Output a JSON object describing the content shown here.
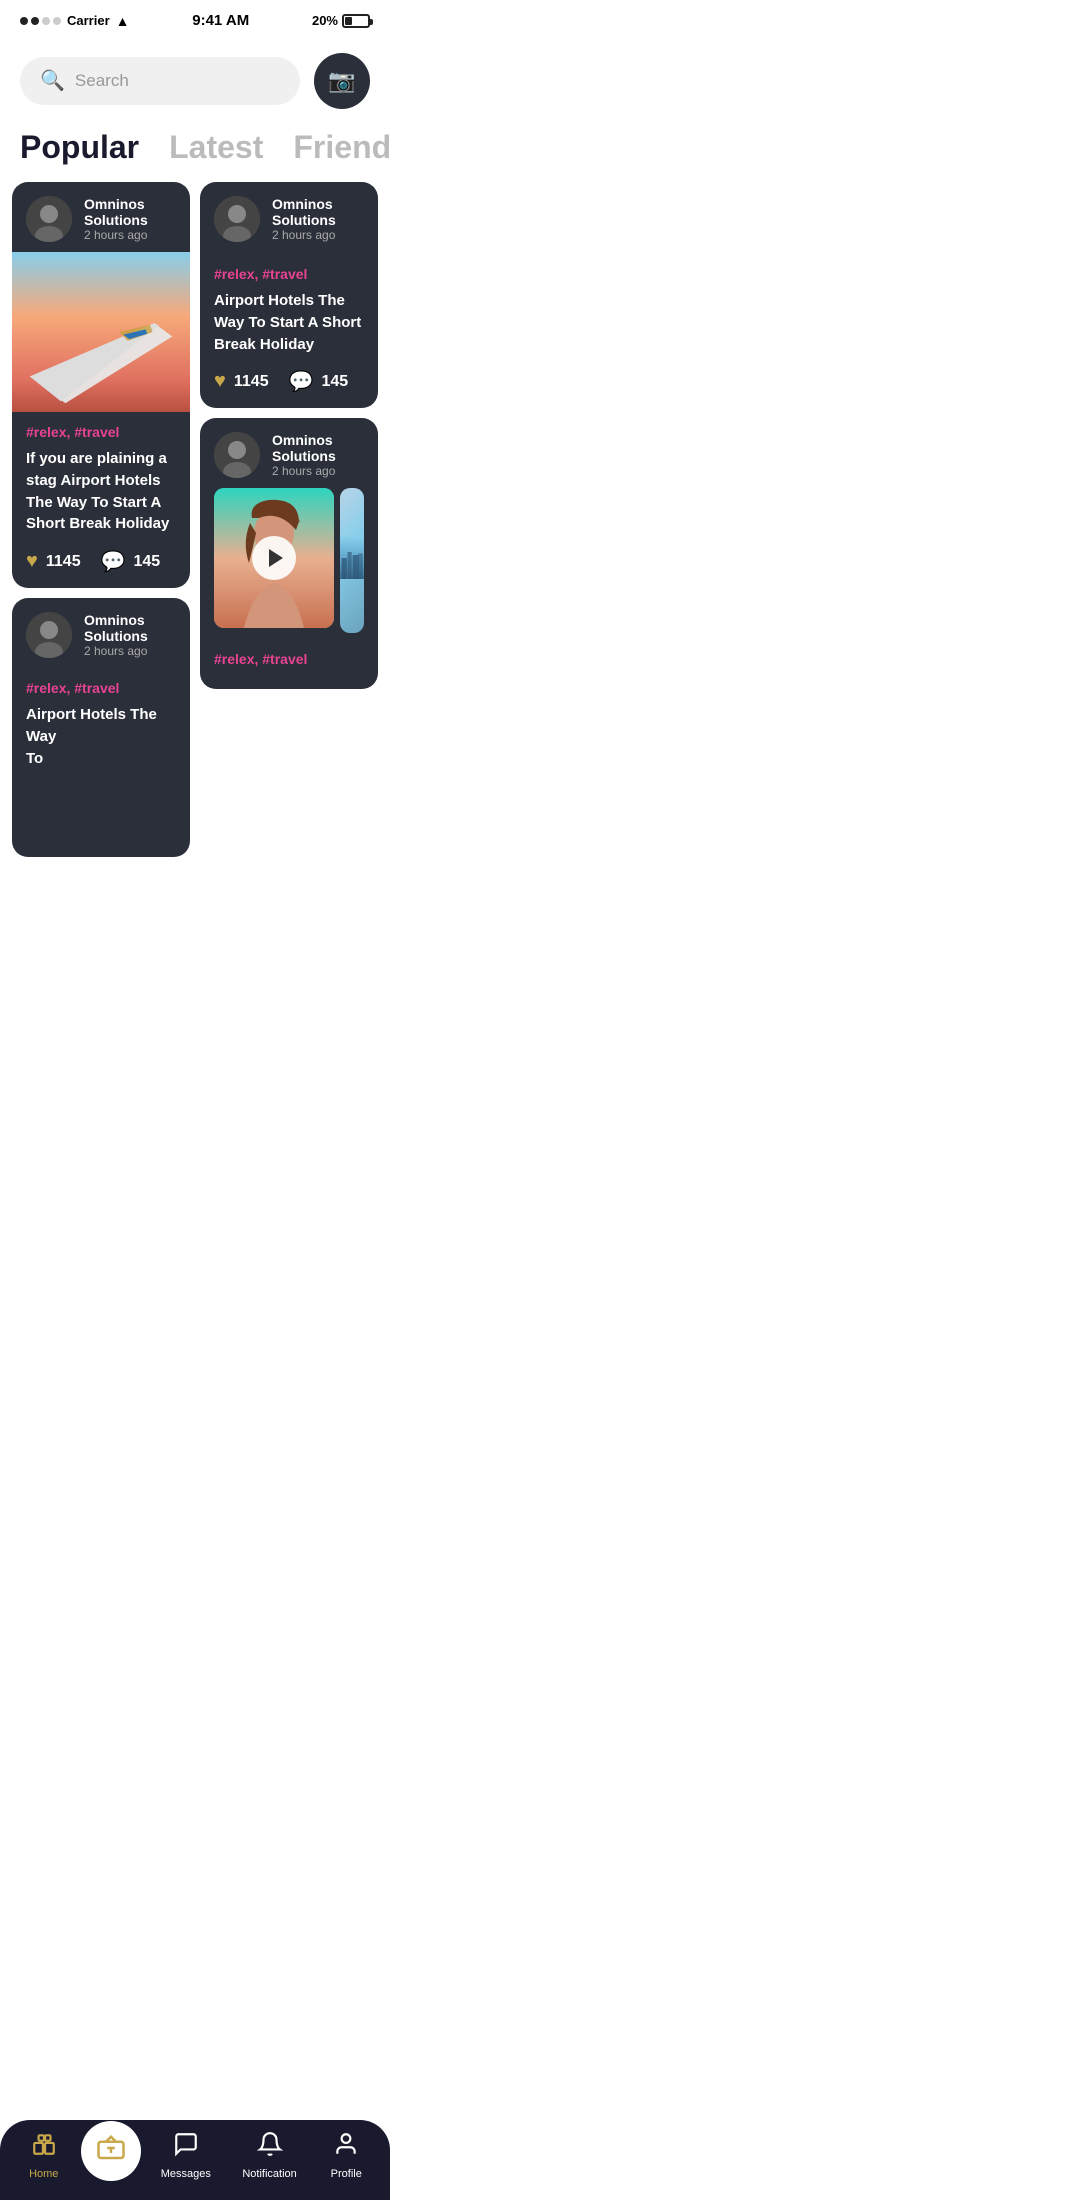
{
  "statusBar": {
    "carrier": "Carrier",
    "time": "9:41 AM",
    "battery": "20%"
  },
  "search": {
    "placeholder": "Search"
  },
  "tabs": [
    {
      "label": "Popular",
      "active": true
    },
    {
      "label": "Latest",
      "active": false
    },
    {
      "label": "Friends",
      "active": false
    }
  ],
  "cards": [
    {
      "id": "card1",
      "user": "Omninos Solutions",
      "time": "2 hours ago",
      "hasImage": true,
      "tags": "#relex, #travel",
      "title": "If you are plaining a stag Airport Hotels The Way To Start A Short Break Holiday",
      "likes": "1145",
      "comments": "145"
    },
    {
      "id": "card2",
      "user": "Omninos Solutions",
      "time": "2 hours ago",
      "hasImage": false,
      "tags": "#relex, #travel",
      "title": "Airport Hotels The Way To Start A Short Break Holiday",
      "likes": "1145",
      "comments": "145"
    },
    {
      "id": "card3",
      "user": "Omninos Solutions",
      "time": "2 hours ago",
      "hasImage": true,
      "hasVideo": true,
      "tags": "#relex, #travel",
      "title": "",
      "likes": "",
      "comments": ""
    },
    {
      "id": "card4",
      "user": "Omninos Solutions",
      "time": "2 hours ago",
      "hasImage": false,
      "tags": "#relex, #travel",
      "title": "Airport Hotels The Way To...",
      "likes": "",
      "comments": ""
    }
  ],
  "bottomNav": {
    "items": [
      {
        "id": "home",
        "label": "Home",
        "active": true
      },
      {
        "id": "tv",
        "label": "",
        "active": false,
        "isCenter": true
      },
      {
        "id": "messages",
        "label": "Messages",
        "active": false
      },
      {
        "id": "notification",
        "label": "Notification",
        "active": false
      },
      {
        "id": "profile",
        "label": "Profile",
        "active": false
      }
    ]
  }
}
